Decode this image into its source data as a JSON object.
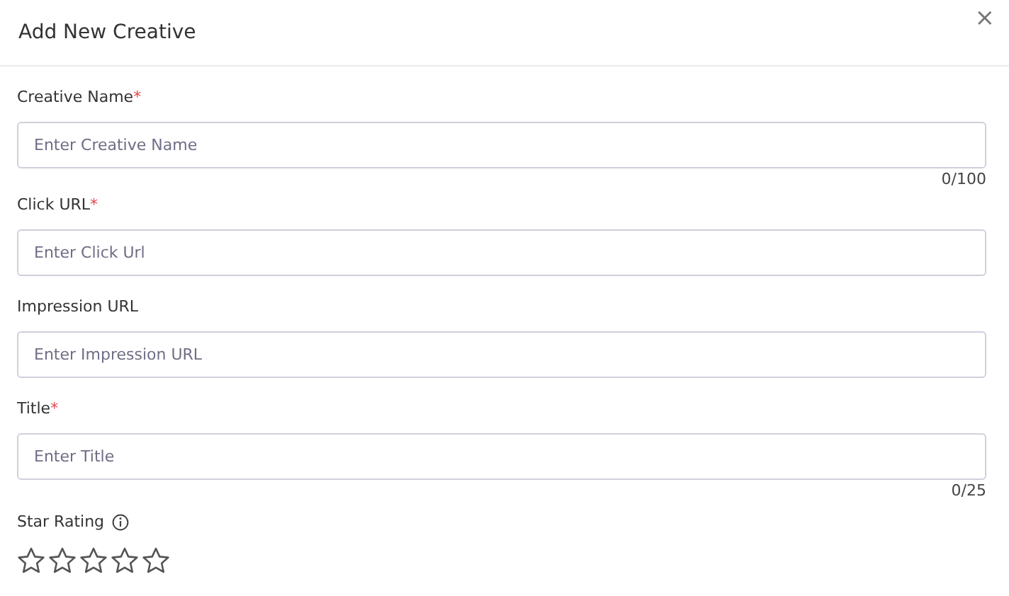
{
  "dialog": {
    "title": "Add New Creative",
    "close": "×"
  },
  "fields": [
    {
      "label": "Creative Name",
      "required_mark": "*",
      "placeholder": "Enter Creative Name",
      "counter": "0/100"
    },
    {
      "label": "Click URL",
      "required_mark": "*",
      "placeholder": "Enter Click Url"
    },
    {
      "label": "Impression URL",
      "placeholder": "Enter Impression URL"
    },
    {
      "label": "Title",
      "required_mark": "*",
      "placeholder": "Enter Title",
      "counter": "0/25"
    }
  ],
  "star_rating": {
    "label": "Star Rating",
    "stars": 0
  }
}
